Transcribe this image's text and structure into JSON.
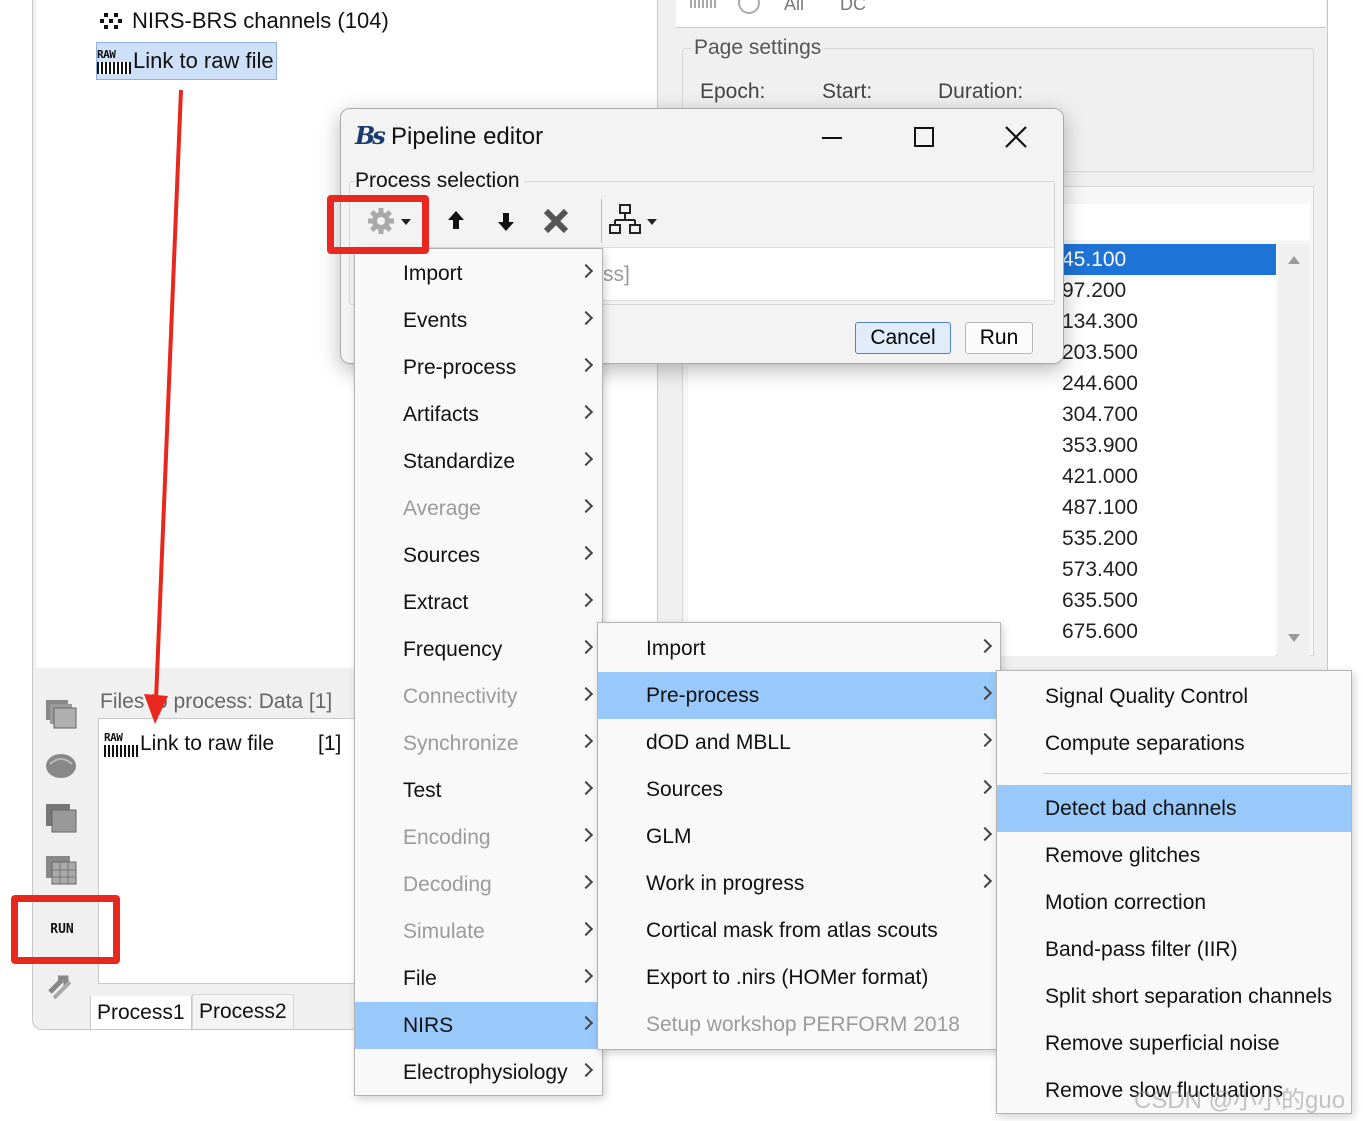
{
  "tree": {
    "channels_label": "NIRS-BRS channels (104)",
    "raw_label": "Link to raw file",
    "raw_icon_text": "RAW"
  },
  "right_panel": {
    "toolbar_items": [
      "All",
      "DC"
    ],
    "page_settings_title": "Page settings",
    "epoch_label": "Epoch:",
    "start_label": "Start:",
    "duration_label": "Duration:",
    "event_times": [
      "45.100",
      "97.200",
      "134.300",
      "203.500",
      "244.600",
      "304.700",
      "353.900",
      "421.000",
      "487.100",
      "535.200",
      "573.400",
      "635.500",
      "675.600"
    ],
    "selected_index": 0
  },
  "process_panel": {
    "files_title": "Files to process: Data [1]",
    "file_label": "Link to raw file",
    "file_count": "[1]",
    "run_icon_text": "RUN",
    "tabs": [
      "Process1",
      "Process2"
    ]
  },
  "dialog": {
    "title": "Pipeline editor",
    "process_selection_label": "Process selection",
    "list_hint": "ss]",
    "cancel_label": "Cancel",
    "run_label": "Run"
  },
  "menu1": {
    "items": [
      {
        "label": "Import",
        "enabled": true
      },
      {
        "label": "Events",
        "enabled": true
      },
      {
        "label": "Pre-process",
        "enabled": true
      },
      {
        "label": "Artifacts",
        "enabled": true
      },
      {
        "label": "Standardize",
        "enabled": true
      },
      {
        "label": "Average",
        "enabled": false
      },
      {
        "label": "Sources",
        "enabled": true
      },
      {
        "label": "Extract",
        "enabled": true
      },
      {
        "label": "Frequency",
        "enabled": true
      },
      {
        "label": "Connectivity",
        "enabled": false
      },
      {
        "label": "Synchronize",
        "enabled": false
      },
      {
        "label": "Test",
        "enabled": true
      },
      {
        "label": "Encoding",
        "enabled": false
      },
      {
        "label": "Decoding",
        "enabled": false
      },
      {
        "label": "Simulate",
        "enabled": false
      },
      {
        "label": "File",
        "enabled": true
      },
      {
        "label": "NIRS",
        "enabled": true,
        "highlighted": true
      },
      {
        "label": "Electrophysiology",
        "enabled": true
      }
    ]
  },
  "menu2": {
    "items": [
      {
        "label": "Import",
        "submenu": true
      },
      {
        "label": "Pre-process",
        "submenu": true,
        "highlighted": true
      },
      {
        "label": "dOD and MBLL",
        "submenu": true
      },
      {
        "label": "Sources",
        "submenu": true
      },
      {
        "label": "GLM",
        "submenu": true
      },
      {
        "label": "Work in progress",
        "submenu": true
      },
      {
        "label": "Cortical mask from atlas scouts",
        "submenu": false
      },
      {
        "label": "Export to .nirs (HOMer format)",
        "submenu": false
      },
      {
        "label": "Setup workshop PERFORM 2018",
        "submenu": false,
        "enabled": false
      }
    ]
  },
  "menu3": {
    "items": [
      {
        "label": "Signal Quality Control"
      },
      {
        "label": "Compute separations"
      },
      {
        "label": "Detect bad channels",
        "highlighted": true
      },
      {
        "label": "Remove glitches"
      },
      {
        "label": "Motion correction"
      },
      {
        "label": "Band-pass filter (IIR)"
      },
      {
        "label": "Split short separation channels"
      },
      {
        "label": "Remove superficial noise"
      },
      {
        "label": "Remove slow fluctuations"
      }
    ]
  },
  "watermark": "CSDN @小小的guo",
  "colors": {
    "highlight": "#99c9fb",
    "selection": "#1e73d6",
    "annotation_red": "#e8281e",
    "disabled_text": "#9b9b9b"
  },
  "icons": [
    "dots-icon",
    "raw-file-icon",
    "gear-icon",
    "arrow-up-icon",
    "arrow-down-icon",
    "delete-icon",
    "pipeline-tree-icon",
    "brainstorm-logo-icon",
    "minimize-icon",
    "maximize-icon",
    "close-icon"
  ]
}
